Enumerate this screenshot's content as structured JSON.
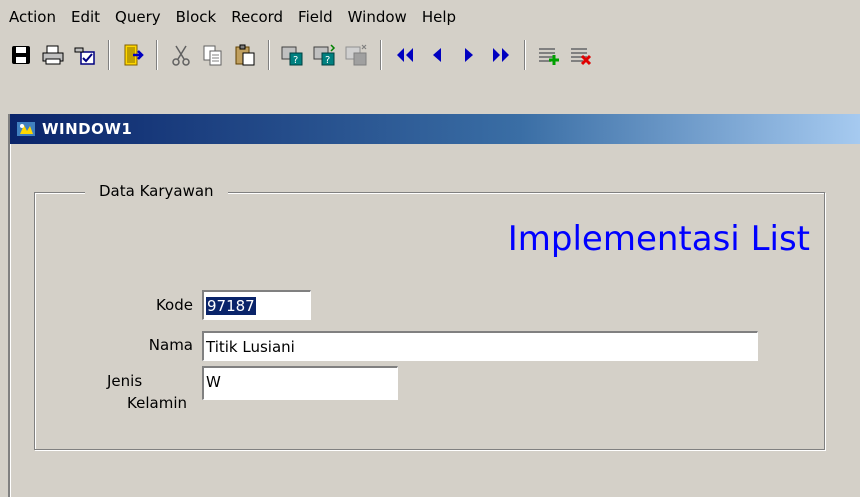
{
  "menu": [
    "Action",
    "Edit",
    "Query",
    "Block",
    "Record",
    "Field",
    "Window",
    "Help"
  ],
  "toolbar": {
    "icons": [
      "save-icon",
      "print-icon",
      "clear-icon",
      "exit-icon",
      "cut-icon",
      "copy-icon",
      "paste-icon",
      "enter-query-icon",
      "execute-query-icon",
      "cancel-query-icon",
      "first-record-icon",
      "previous-record-icon",
      "next-record-icon",
      "last-record-icon",
      "insert-record-icon",
      "delete-record-icon"
    ]
  },
  "window": {
    "title": "WINDOW1"
  },
  "form": {
    "group_label": "Data Karyawan",
    "heading": "Implementasi List",
    "fields": {
      "kode": {
        "label": "Kode",
        "value": "97187"
      },
      "nama": {
        "label": "Nama",
        "value": "Titik Lusiani"
      },
      "jenis_kelamin": {
        "label_line1": "Jenis",
        "label_line2": "Kelamin",
        "value": "W"
      }
    }
  },
  "colors": {
    "title_bar": "#0a246a",
    "heading": "#0000ff",
    "selection": "#0a246a",
    "face": "#d4d0c8"
  }
}
